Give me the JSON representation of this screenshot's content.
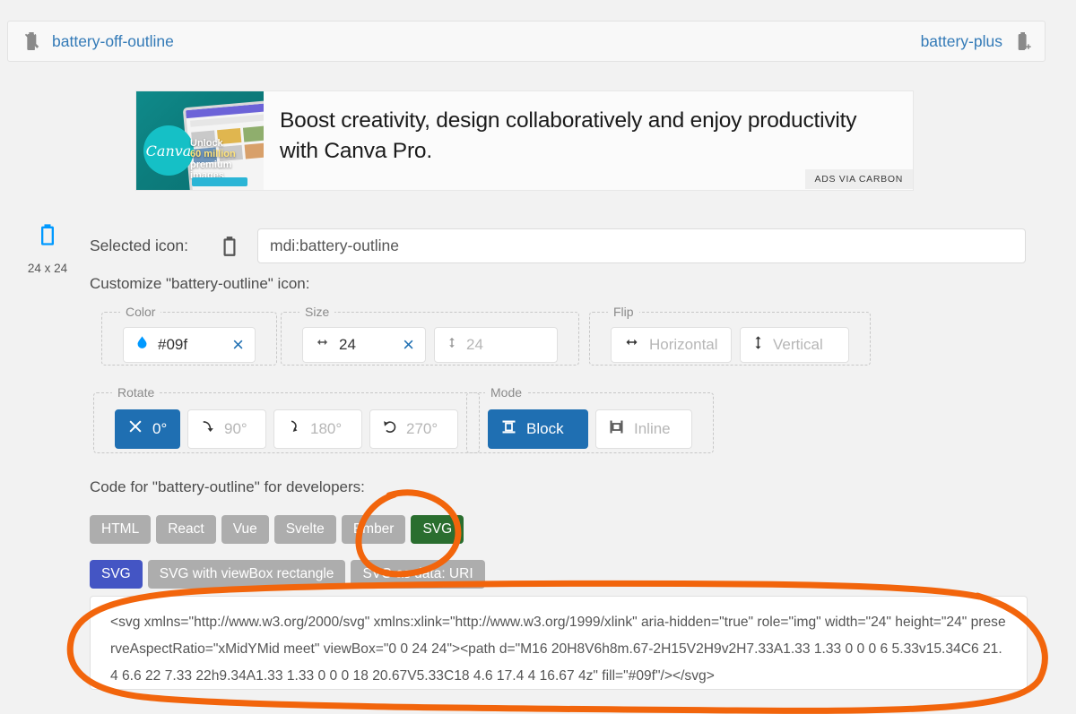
{
  "nav": {
    "prev_label": "battery-off-outline",
    "prev_icon": "battery-off-outline-icon",
    "next_label": "battery-plus",
    "next_icon": "battery-plus-icon"
  },
  "ad": {
    "text": "Boost creativity, design collaboratively and enjoy productivity with Canva Pro.",
    "brand": "Canva",
    "overlay_line1": "Unlock",
    "overlay_line2": "60 million",
    "overlay_line3": "premium",
    "overlay_line4": "images",
    "tag": "ADS VIA CARBON"
  },
  "preview": {
    "size_label": "24 x 24",
    "size_sep": "x",
    "icon": "battery-outline-icon",
    "color": "#09f"
  },
  "selected": {
    "label": "Selected icon:",
    "icon": "battery-outline-icon",
    "value": "mdi:battery-outline"
  },
  "customize": {
    "title": "Customize \"battery-outline\" icon:",
    "color": {
      "legend": "Color",
      "value": "#09f",
      "swatch_icon": "water-drop-icon",
      "clear_icon": "close-icon",
      "clear_label": "×"
    },
    "size": {
      "legend": "Size",
      "width_value": "24",
      "width_icon": "arrow-left-right-icon",
      "width_clear": "×",
      "height_value": "24",
      "height_icon": "arrow-up-down-icon"
    },
    "flip": {
      "legend": "Flip",
      "horizontal_label": "Horizontal",
      "horizontal_icon": "arrow-left-right-icon",
      "vertical_label": "Vertical",
      "vertical_icon": "arrow-up-down-icon"
    },
    "rotate": {
      "legend": "Rotate",
      "options": [
        {
          "label": "0°",
          "icon": "close-icon",
          "active": true
        },
        {
          "label": "90°",
          "icon": "rotate-90-icon",
          "active": false
        },
        {
          "label": "180°",
          "icon": "rotate-180-icon",
          "active": false
        },
        {
          "label": "270°",
          "icon": "rotate-270-icon",
          "active": false
        }
      ]
    },
    "mode": {
      "legend": "Mode",
      "options": [
        {
          "label": "Block",
          "icon": "block-mode-icon",
          "active": true
        },
        {
          "label": "Inline",
          "icon": "inline-mode-icon",
          "active": false
        }
      ]
    }
  },
  "code": {
    "title": "Code for \"battery-outline\" for developers:",
    "framework_tabs": [
      {
        "label": "HTML",
        "state": "inactive"
      },
      {
        "label": "React",
        "state": "inactive"
      },
      {
        "label": "Vue",
        "state": "inactive"
      },
      {
        "label": "Svelte",
        "state": "inactive"
      },
      {
        "label": "Ember",
        "state": "inactive"
      },
      {
        "label": "SVG",
        "state": "active-green"
      }
    ],
    "format_tabs": [
      {
        "label": "SVG",
        "state": "active-blue"
      },
      {
        "label": "SVG with viewBox rectangle",
        "state": "inactive"
      },
      {
        "label": "SVG as data: URI",
        "state": "inactive"
      }
    ],
    "snippet": "<svg xmlns=\"http://www.w3.org/2000/svg\" xmlns:xlink=\"http://www.w3.org/1999/xlink\" aria-hidden=\"true\" role=\"img\" width=\"24\" height=\"24\" preserveAspectRatio=\"xMidYMid meet\" viewBox=\"0 0 24 24\"><path d=\"M16 20H8V6h8m.67-2H15V2H9v2H7.33A1.33 1.33 0 0 0 6 5.33v15.34C6 21.4 6.6 22 7.33 22h9.34A1.33 1.33 0 0 0 18 20.67V5.33C18 4.6 17.4 4 16.67 4z\" fill=\"#09f\"/></svg>"
  },
  "annotations": {
    "accent_color": "#f2650c",
    "shapes": [
      "circle-around-svg-tab",
      "circle-around-code-box"
    ]
  },
  "colors": {
    "link": "#337ab7",
    "active_blue": "#1f6fb2",
    "tab_green": "#2a6e2f",
    "tab_blue": "#4455c4",
    "icon_blue": "#09f"
  }
}
